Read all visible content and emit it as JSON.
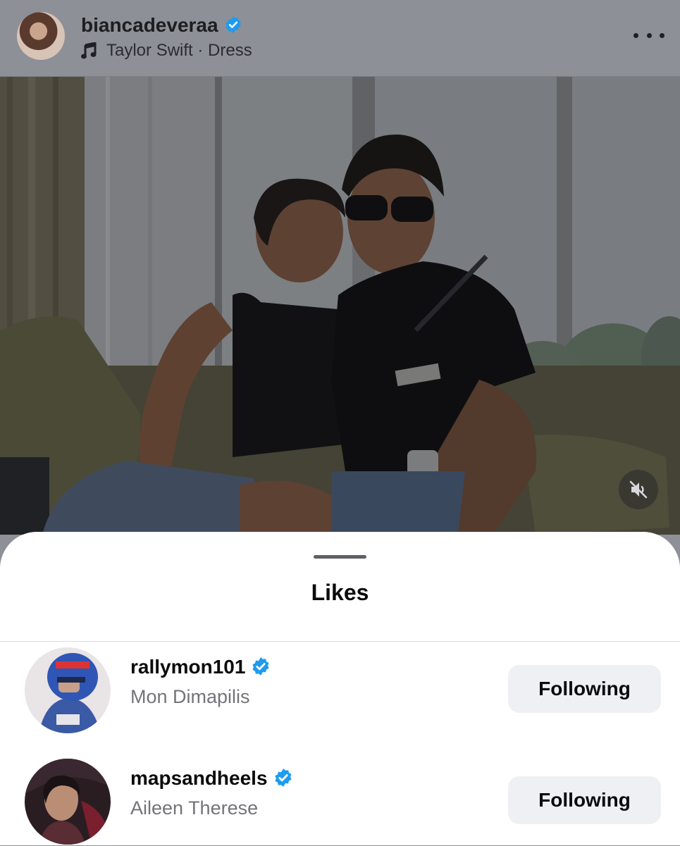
{
  "post": {
    "username": "biancadeveraa",
    "verified": true,
    "audio": "Taylor Swift · Dress",
    "icons": {
      "audio": "music-note-icon",
      "more": "more-options-icon",
      "mute": "muted-speaker-icon"
    }
  },
  "likes_sheet": {
    "title": "Likes",
    "users": [
      {
        "username": "rallymon101",
        "full_name": "Mon Dimapilis",
        "verified": true,
        "button_label": "Following"
      },
      {
        "username": "mapsandheels",
        "full_name": "Aileen Therese",
        "verified": true,
        "button_label": "Following"
      }
    ]
  },
  "colors": {
    "verified_badge": "#1d9bf0",
    "sheet_bg": "#ffffff",
    "button_bg": "#eef0f3"
  }
}
